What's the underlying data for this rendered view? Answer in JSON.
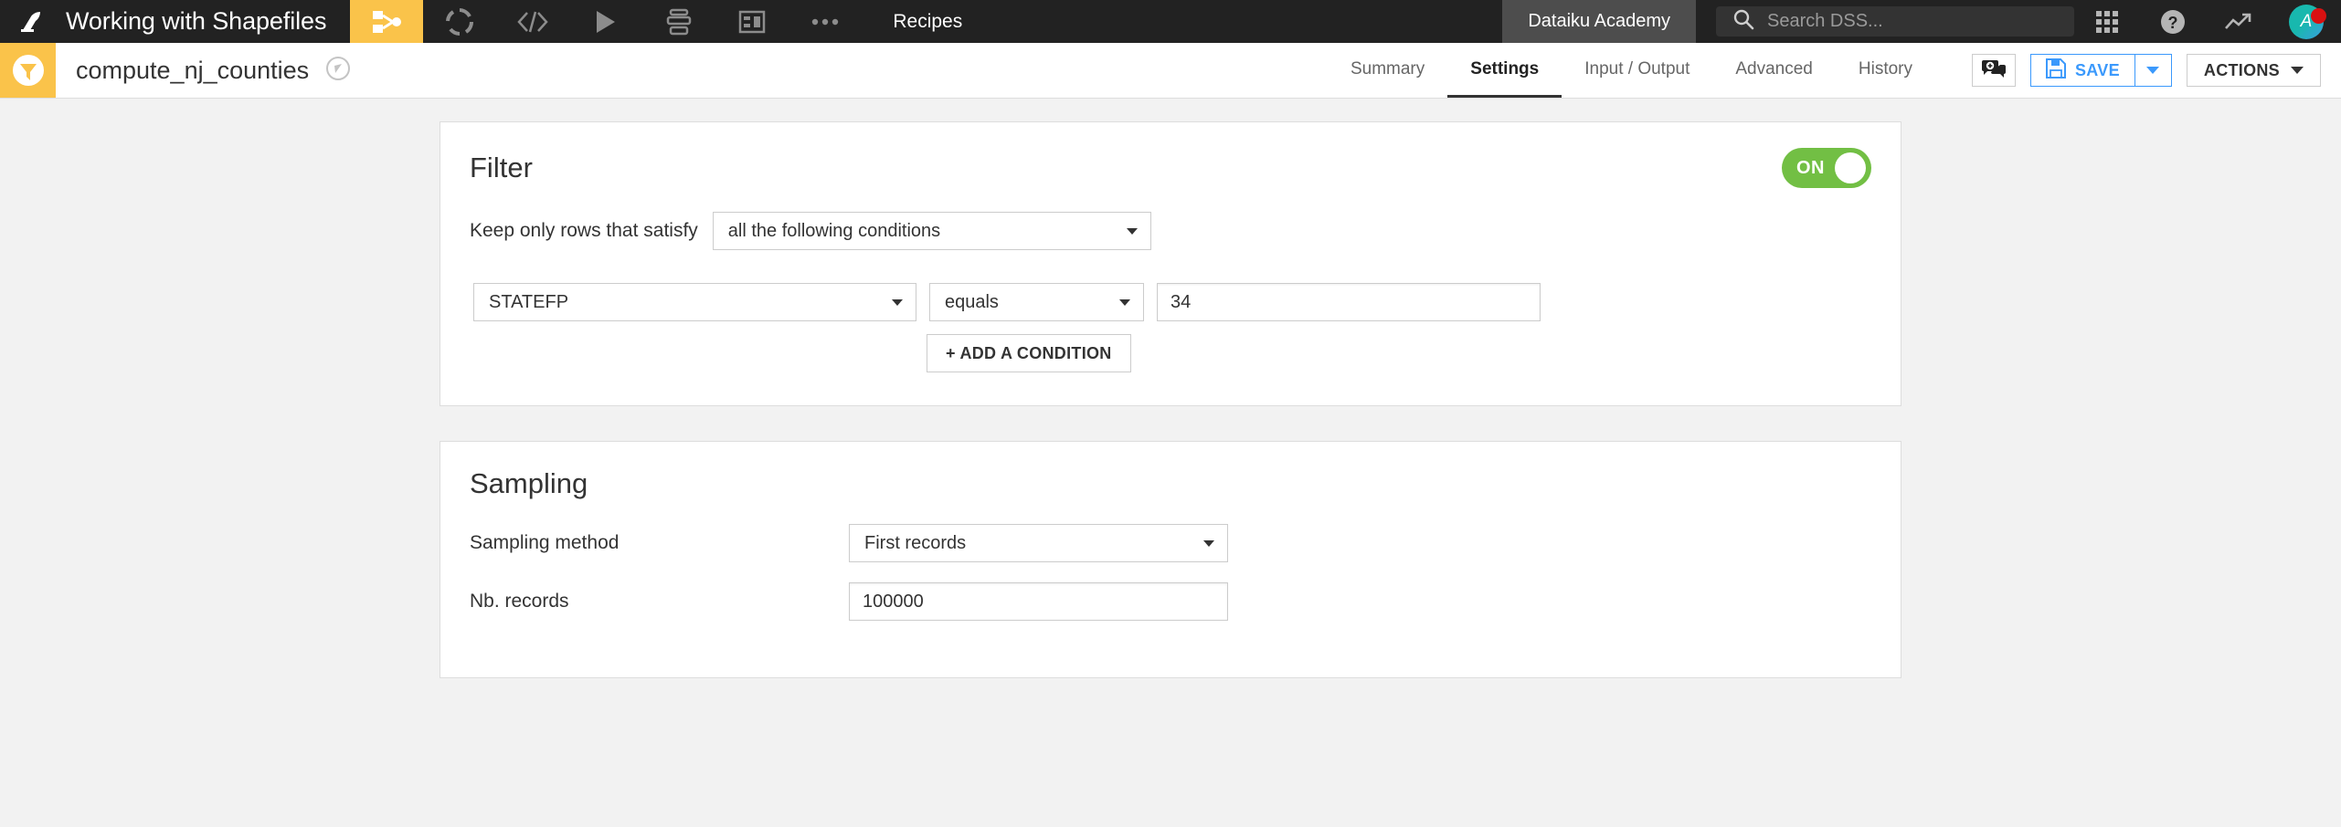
{
  "topbar": {
    "logo_icon": "dataiku-bird-logo",
    "project_name": "Working with Shapefiles",
    "icons": [
      {
        "name": "flow-icon",
        "active": true
      },
      {
        "name": "dashboard-circle-icon",
        "active": false
      },
      {
        "name": "code-icon",
        "active": false
      },
      {
        "name": "play-icon",
        "active": false
      },
      {
        "name": "jobs-stack-icon",
        "active": false
      },
      {
        "name": "dashboards-icon",
        "active": false
      },
      {
        "name": "more-ellipsis-icon",
        "active": false
      }
    ],
    "recipes_label": "Recipes",
    "academy_label": "Dataiku Academy",
    "search_placeholder": "Search DSS...",
    "search_icon": "search-icon",
    "apps_icon": "apps-grid-icon",
    "help_icon": "help-question-icon",
    "trend_icon": "trend-up-icon",
    "avatar_initial": "A"
  },
  "subheader": {
    "recipe_icon": "filter-funnel-icon",
    "recipe_name": "compute_nj_counties",
    "navigate_icon": "compass-navigate-icon",
    "tabs": [
      {
        "label": "Summary",
        "active": false
      },
      {
        "label": "Settings",
        "active": true
      },
      {
        "label": "Input / Output",
        "active": false
      },
      {
        "label": "Advanced",
        "active": false
      },
      {
        "label": "History",
        "active": false
      }
    ],
    "discussion_icon": "add-discussion-icon",
    "save_label": "SAVE",
    "save_icon": "floppy-disk-icon",
    "actions_label": "ACTIONS"
  },
  "filter": {
    "title": "Filter",
    "toggle_state": "ON",
    "keep_rows_label": "Keep only rows that satisfy",
    "condition_mode": "all the following conditions",
    "condition": {
      "field": "STATEFP",
      "operator": "equals",
      "value": "34"
    },
    "add_condition_label": "+ ADD A CONDITION"
  },
  "sampling": {
    "title": "Sampling",
    "method_label": "Sampling method",
    "method_value": "First records",
    "nb_records_label": "Nb. records",
    "nb_records_value": "100000"
  },
  "colors": {
    "accent_yellow": "#fac34a",
    "toggle_green": "#72bf44",
    "link_blue": "#3b99fc",
    "topbar_dark": "#222222",
    "badge_red": "#d81111"
  }
}
